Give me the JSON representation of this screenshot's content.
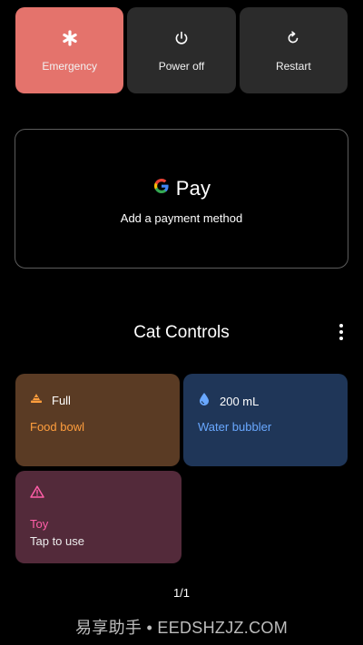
{
  "power_menu": {
    "emergency": {
      "label": "Emergency",
      "icon": "asterisk-icon",
      "color": "#e4736c"
    },
    "power_off": {
      "label": "Power off",
      "icon": "power-icon"
    },
    "restart": {
      "label": "Restart",
      "icon": "restart-icon"
    }
  },
  "wallet": {
    "brand": "Pay",
    "subtitle": "Add a payment method"
  },
  "controls": {
    "title": "Cat Controls",
    "tiles": [
      {
        "status": "Full",
        "title": "Food bowl",
        "subtitle": "",
        "icon": "food-bowl-icon",
        "color": "#5a3b24",
        "accent": "#ff9e3d"
      },
      {
        "status": "200 mL",
        "title": "Water bubbler",
        "subtitle": "",
        "icon": "water-drop-icon",
        "color": "#1f3658",
        "accent": "#69a8ff"
      },
      {
        "status": "",
        "title": "Toy",
        "subtitle": "Tap to use",
        "icon": "warning-icon",
        "color": "#532a3a",
        "accent": "#ff5ea8"
      }
    ]
  },
  "pager": "1/1",
  "watermark": "易享助手 • EEDSHZJZ.COM"
}
